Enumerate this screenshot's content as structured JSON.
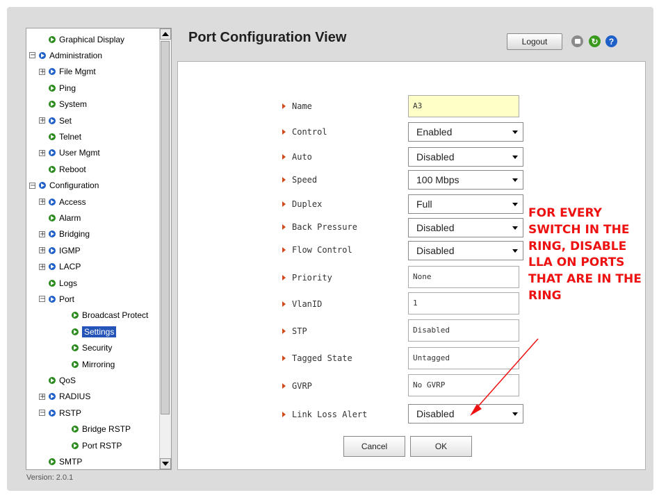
{
  "nav_tree": {
    "items": [
      {
        "label": "Graphical Display",
        "depth": 1,
        "expander": "",
        "dot": "green",
        "selected": false
      },
      {
        "label": "Administration",
        "depth": 0,
        "expander": "−",
        "dot": "blue",
        "selected": false
      },
      {
        "label": "File Mgmt",
        "depth": 1,
        "expander": "+",
        "dot": "blue",
        "selected": false
      },
      {
        "label": "Ping",
        "depth": 1,
        "expander": "",
        "dot": "green",
        "selected": false
      },
      {
        "label": "System",
        "depth": 1,
        "expander": "",
        "dot": "green",
        "selected": false
      },
      {
        "label": "Set",
        "depth": 1,
        "expander": "+",
        "dot": "blue",
        "selected": false
      },
      {
        "label": "Telnet",
        "depth": 1,
        "expander": "",
        "dot": "green",
        "selected": false
      },
      {
        "label": "User Mgmt",
        "depth": 1,
        "expander": "+",
        "dot": "blue",
        "selected": false
      },
      {
        "label": "Reboot",
        "depth": 1,
        "expander": "",
        "dot": "green",
        "selected": false
      },
      {
        "label": "Configuration",
        "depth": 0,
        "expander": "−",
        "dot": "blue",
        "selected": false
      },
      {
        "label": "Access",
        "depth": 1,
        "expander": "+",
        "dot": "blue",
        "selected": false
      },
      {
        "label": "Alarm",
        "depth": 1,
        "expander": "",
        "dot": "green",
        "selected": false
      },
      {
        "label": "Bridging",
        "depth": 1,
        "expander": "+",
        "dot": "blue",
        "selected": false
      },
      {
        "label": "IGMP",
        "depth": 1,
        "expander": "+",
        "dot": "blue",
        "selected": false
      },
      {
        "label": "LACP",
        "depth": 1,
        "expander": "+",
        "dot": "blue",
        "selected": false
      },
      {
        "label": "Logs",
        "depth": 1,
        "expander": "",
        "dot": "green",
        "selected": false
      },
      {
        "label": "Port",
        "depth": 1,
        "expander": "−",
        "dot": "blue",
        "selected": false
      },
      {
        "label": "Broadcast Protect",
        "depth": 2,
        "expander": "",
        "dot": "green",
        "selected": false
      },
      {
        "label": "Settings",
        "depth": 2,
        "expander": "",
        "dot": "green",
        "selected": true
      },
      {
        "label": "Security",
        "depth": 2,
        "expander": "",
        "dot": "green",
        "selected": false
      },
      {
        "label": "Mirroring",
        "depth": 2,
        "expander": "",
        "dot": "green",
        "selected": false
      },
      {
        "label": "QoS",
        "depth": 1,
        "expander": "",
        "dot": "green",
        "selected": false
      },
      {
        "label": "RADIUS",
        "depth": 1,
        "expander": "+",
        "dot": "blue",
        "selected": false
      },
      {
        "label": "RSTP",
        "depth": 1,
        "expander": "−",
        "dot": "blue",
        "selected": false
      },
      {
        "label": "Bridge RSTP",
        "depth": 2,
        "expander": "",
        "dot": "green",
        "selected": false
      },
      {
        "label": "Port RSTP",
        "depth": 2,
        "expander": "",
        "dot": "green",
        "selected": false
      },
      {
        "label": "SMTP",
        "depth": 1,
        "expander": "",
        "dot": "green",
        "selected": false
      }
    ]
  },
  "footer": {
    "version": "Version: 2.0.1"
  },
  "header": {
    "title": "Port Configuration View",
    "logout_label": "Logout",
    "icons": [
      "save-icon",
      "refresh-icon",
      "help-icon"
    ],
    "help_glyph": "?",
    "refresh_glyph": "↻"
  },
  "form": {
    "name": {
      "label": "Name",
      "value": "A3"
    },
    "control": {
      "label": "Control",
      "value": "Enabled"
    },
    "auto": {
      "label": "Auto",
      "value": "Disabled"
    },
    "speed": {
      "label": "Speed",
      "value": "100 Mbps"
    },
    "duplex": {
      "label": "Duplex",
      "value": "Full"
    },
    "back_pressure": {
      "label": "Back Pressure",
      "value": "Disabled"
    },
    "flow_control": {
      "label": "Flow Control",
      "value": "Disabled"
    },
    "priority": {
      "label": "Priority",
      "value": "None"
    },
    "vlanid": {
      "label": "VlanID",
      "value": "1"
    },
    "stp": {
      "label": "STP",
      "value": "Disabled"
    },
    "tagged_state": {
      "label": "Tagged State",
      "value": "Untagged"
    },
    "gvrp": {
      "label": "GVRP",
      "value": "No GVRP"
    },
    "link_loss_alert": {
      "label": "Link Loss Alert",
      "value": "Disabled"
    }
  },
  "buttons": {
    "cancel": "Cancel",
    "ok": "OK"
  },
  "annotation": {
    "lines": [
      "FOR EVERY",
      "SWITCH IN THE",
      "RING, DISABLE",
      "LLA ON PORTS",
      "THAT ARE IN THE",
      "RING"
    ],
    "color": "#ee1111"
  },
  "colors": {
    "label_arrow": "#d04a1c",
    "selection": "#2454b8",
    "name_field_bg": "#ffffc8"
  }
}
